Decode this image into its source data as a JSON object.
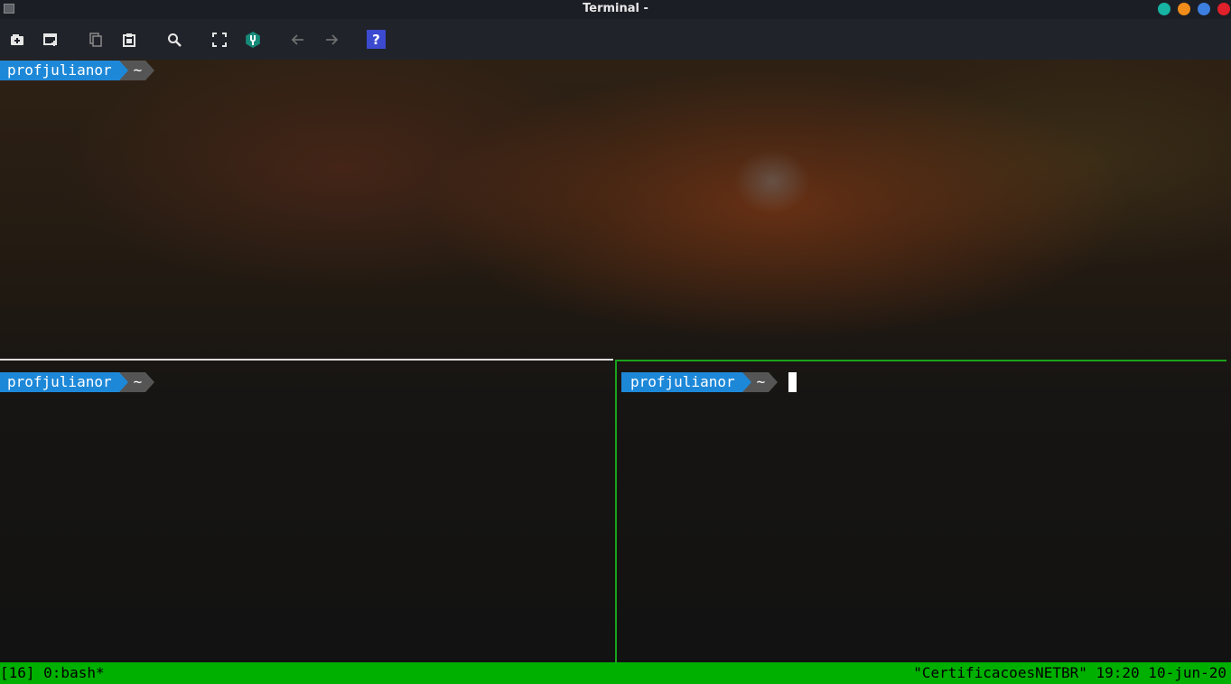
{
  "window": {
    "title": "Terminal -",
    "buttons": [
      {
        "name": "minimize",
        "color": "#17b3a3"
      },
      {
        "name": "maximize",
        "color": "#f08c1a"
      },
      {
        "name": "restore",
        "color": "#3d7fe0"
      },
      {
        "name": "close",
        "color": "#e0202a"
      }
    ]
  },
  "toolbar": {
    "icons": [
      "new-tab-icon",
      "new-window-icon",
      "copy-icon",
      "paste-icon",
      "search-icon",
      "fullscreen-icon",
      "settings-wrench-icon",
      "back-arrow-icon",
      "forward-arrow-icon",
      "help-icon"
    ],
    "help_label": "?"
  },
  "panes": [
    {
      "user": "profjulianor",
      "dir": "~",
      "active": false
    },
    {
      "user": "profjulianor",
      "dir": "~",
      "active": false
    },
    {
      "user": "profjulianor",
      "dir": "~",
      "active": true
    }
  ],
  "statusbar": {
    "left": "[16] 0:bash*",
    "right": "\"CertificacoesNETBR\" 19:20 10-jun-20",
    "color": "#00b000"
  }
}
